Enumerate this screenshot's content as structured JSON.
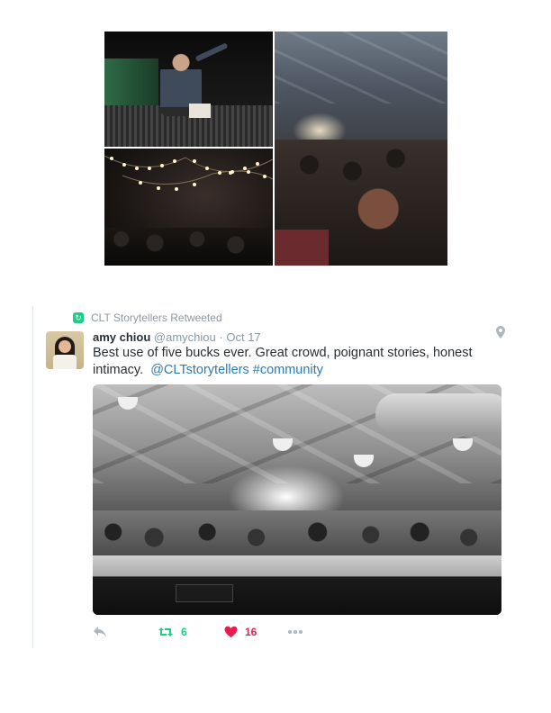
{
  "retweet_context": {
    "text": "CLT Storytellers Retweeted",
    "icon": "retweet-icon"
  },
  "tweet": {
    "author_name": "amy chiou",
    "author_handle": "@amychiou",
    "separator": "·",
    "date": "Oct 17",
    "text_main": "Best use of five bucks ever. Great crowd, poignant stories, honest intimacy.",
    "mention": "@CLTstorytellers",
    "hashtag": "#community",
    "location_icon": "map-pin-icon"
  },
  "actions": {
    "reply": {
      "icon": "reply-icon"
    },
    "retweet": {
      "icon": "retweet-icon",
      "count": "6"
    },
    "like": {
      "icon": "heart-icon",
      "count": "16"
    },
    "more": {
      "icon": "more-dots-icon"
    }
  },
  "colors": {
    "link": "#2b7bb9",
    "retweet_green": "#19cf86",
    "like_red": "#e81c4f",
    "muted": "#8899a6"
  }
}
